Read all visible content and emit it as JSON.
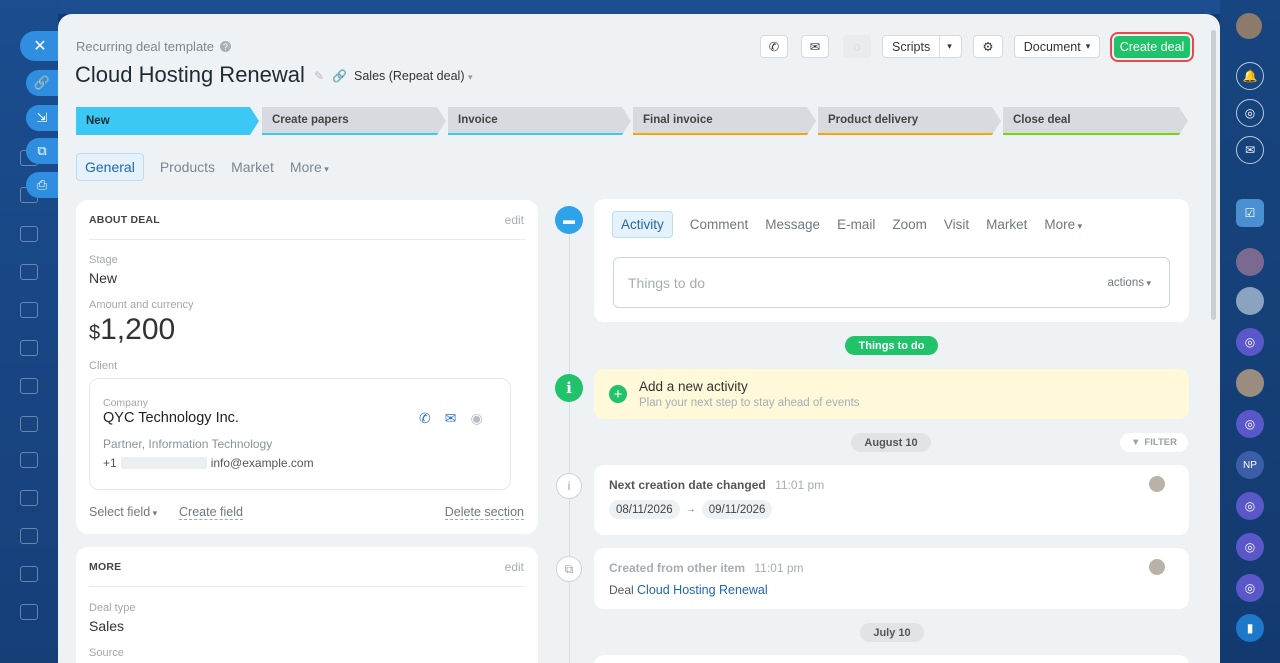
{
  "header": {
    "template_label": "Recurring deal template",
    "title": "Cloud Hosting Renewal",
    "pipeline": "Sales (Repeat deal)"
  },
  "toolbar": {
    "scripts_label": "Scripts",
    "document_label": "Document",
    "create_deal_label": "Create deal"
  },
  "stages": [
    {
      "label": "New",
      "color": "#3bc8f5"
    },
    {
      "label": "Create papers",
      "color": "#3bc8f5"
    },
    {
      "label": "Invoice",
      "color": "#3bc8f5"
    },
    {
      "label": "Final invoice",
      "color": "#f7a700"
    },
    {
      "label": "Product delivery",
      "color": "#f7a700"
    },
    {
      "label": "Close deal",
      "color": "#7bd500"
    }
  ],
  "tabs": [
    "General",
    "Products",
    "Market",
    "More"
  ],
  "about": {
    "heading": "ABOUT DEAL",
    "edit": "edit",
    "stage_label": "Stage",
    "stage_value": "New",
    "amount_label": "Amount and currency",
    "currency": "$",
    "amount": "1,200",
    "client_label": "Client",
    "company_label": "Company",
    "company_name": "QYC Technology Inc.",
    "company_type": "Partner, Information Technology",
    "phone_prefix": "+1",
    "email": "info@example.com",
    "select_field": "Select field",
    "create_field": "Create field",
    "delete_section": "Delete section"
  },
  "more_section": {
    "heading": "MORE",
    "edit": "edit",
    "deal_type_label": "Deal type",
    "deal_type_value": "Sales",
    "source_label": "Source"
  },
  "activity": {
    "tabs": [
      "Activity",
      "Comment",
      "Message",
      "E-mail",
      "Zoom",
      "Visit",
      "Market",
      "More"
    ],
    "placeholder": "Things to do",
    "actions": "actions"
  },
  "timeline": {
    "todo_badge": "Things to do",
    "add_title": "Add a new activity",
    "add_subtitle": "Plan your next step to stay ahead of events",
    "date1": "August 10",
    "filter": "FILTER",
    "event1_title": "Next creation date changed",
    "event1_time": "11:01 pm",
    "event1_from": "08/11/2026",
    "event1_arrow": "→",
    "event1_to": "09/11/2026",
    "event2_title": "Created from other item",
    "event2_time": "11:01 pm",
    "event2_prefix": "Deal",
    "event2_link": "Cloud Hosting Renewal",
    "date2": "July 10"
  },
  "right_rail": {
    "badge": "NP"
  },
  "colors": {
    "accent": "#2067b0",
    "create": "#20c36a",
    "highlight": "#e5484d",
    "todo": "#20c36a"
  }
}
